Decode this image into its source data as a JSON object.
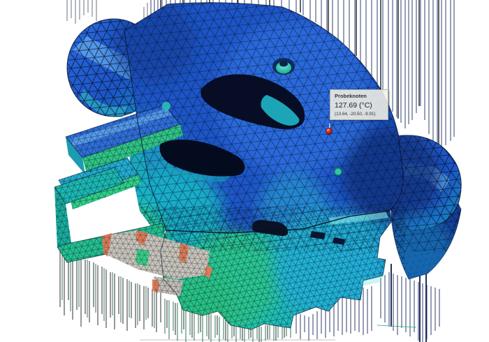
{
  "probe_tooltip": {
    "title": "Probeknoten",
    "value": "127.69 (°C)",
    "coordinates": "(13.64, -20.50, -9.91)"
  },
  "probe_marker": {
    "name": "probe-node-marker",
    "color": "#c42320"
  },
  "result_colors": {
    "cold_blue": "#1d55c6",
    "highlight_blue": "#5fa6ee",
    "cool_cyan": "#1ab8cc",
    "warm_green": "#2fcd84",
    "hot_gray": "#c9c6bf",
    "overheat_orange": "#df7a58",
    "tooltip_background": "#f3f0e5"
  }
}
